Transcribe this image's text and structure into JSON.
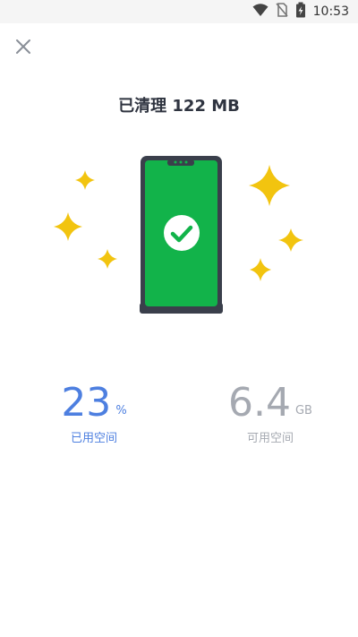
{
  "status_bar": {
    "time": "10:53",
    "icons": [
      "wifi-icon",
      "no-sim-icon",
      "battery-charging-icon"
    ]
  },
  "header": {
    "close_icon": "close-icon",
    "title": "已清理 122 MB"
  },
  "illustration": {
    "phone_color": "#12b34a",
    "sparkle_color": "#f2c40f",
    "check_icon": "check-icon"
  },
  "stats": {
    "used": {
      "value": "23",
      "unit": "%",
      "label": "已用空间",
      "color": "#4d7fe0"
    },
    "free": {
      "value": "6.4",
      "unit": "GB",
      "label": "可用空间",
      "color": "#a5a9b1"
    }
  }
}
